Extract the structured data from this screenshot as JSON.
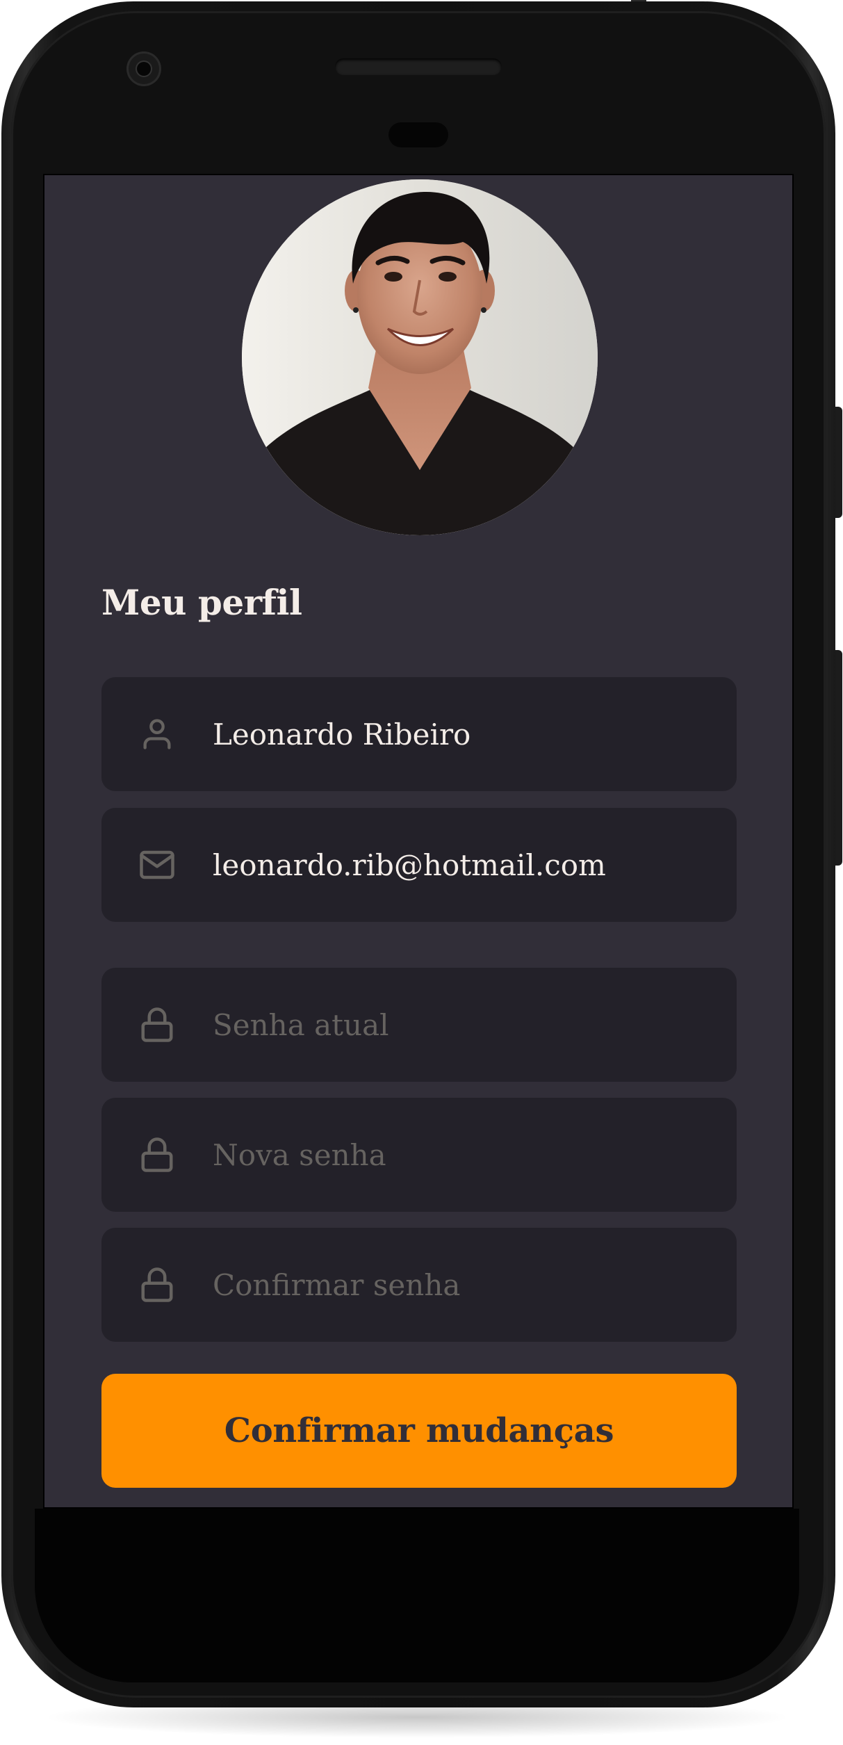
{
  "profile": {
    "title": "Meu perfil",
    "name_value": "Leonardo Ribeiro",
    "email_value": "leonardo.rib@hotmail.com",
    "old_password_placeholder": "Senha atual",
    "new_password_placeholder": "Nova senha",
    "confirm_password_placeholder": "Confirmar senha",
    "submit_label": "Confirmar mudanças"
  },
  "icons": {
    "name": "user-icon",
    "email": "mail-icon",
    "password": "lock-icon"
  },
  "colors": {
    "background": "#312e38",
    "input_background": "#232129",
    "text": "#f4ede8",
    "placeholder": "#666360",
    "accent": "#ff9000"
  }
}
